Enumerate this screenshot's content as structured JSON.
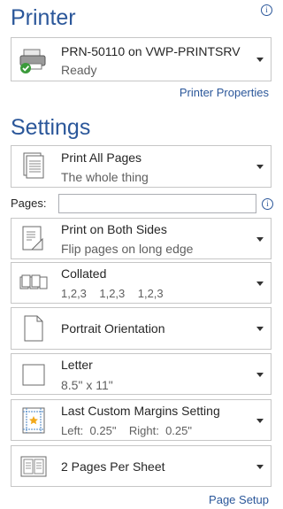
{
  "printer": {
    "section_title": "Printer",
    "name": "PRN-50110 on VWP-PRINTSRV",
    "status": "Ready",
    "properties_link": "Printer Properties"
  },
  "settings": {
    "section_title": "Settings",
    "print_range": {
      "title": "Print All Pages",
      "subtitle": "The whole thing"
    },
    "pages": {
      "label": "Pages:",
      "value": ""
    },
    "sides": {
      "title": "Print on Both Sides",
      "subtitle": "Flip pages on long edge"
    },
    "collation": {
      "title": "Collated",
      "subtitle": "1,2,3    1,2,3    1,2,3"
    },
    "orientation": {
      "title": "Portrait Orientation"
    },
    "paper": {
      "title": "Letter",
      "subtitle": "8.5\" x 11\""
    },
    "margins": {
      "title": "Last Custom Margins Setting",
      "subtitle": "Left:  0.25\"    Right:  0.25\""
    },
    "pages_per_sheet": {
      "title": "2 Pages Per Sheet"
    },
    "page_setup_link": "Page Setup"
  },
  "colors": {
    "accent": "#2b579a",
    "border": "#c6c6c6"
  }
}
